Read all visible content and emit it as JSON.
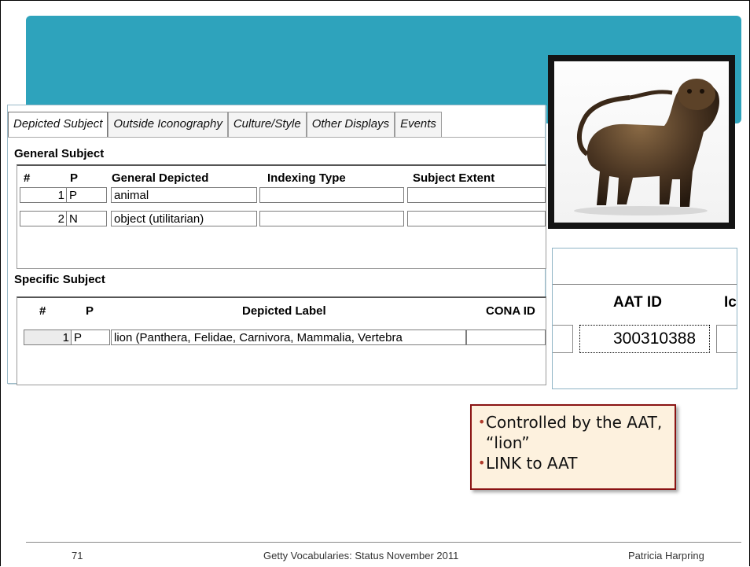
{
  "tabs": [
    "Depicted Subject",
    "Outside Iconography",
    "Culture/Style",
    "Other Displays",
    "Events"
  ],
  "general": {
    "title": "General Subject",
    "headers": [
      "#",
      "P",
      "General Depicted",
      "Indexing Type",
      "Subject Extent"
    ],
    "rows": [
      {
        "num": "1",
        "p": "P",
        "depicted": "animal",
        "type": "",
        "extent": ""
      },
      {
        "num": "2",
        "p": "N",
        "depicted": "object (utilitarian)",
        "type": "",
        "extent": ""
      }
    ]
  },
  "specific": {
    "title": "Specific Subject",
    "headers": [
      "#",
      "P",
      "Depicted Label",
      "CONA ID"
    ],
    "rows": [
      {
        "num": "1",
        "p": "P",
        "label": "lion (Panthera, Felidae, Carnivora, Mammalia, Vertebra",
        "cona": ""
      }
    ]
  },
  "inset": {
    "aat_header": "AAT ID",
    "next_header": "Ic",
    "aat_value": "300310388"
  },
  "callout": {
    "items": [
      "Controlled by the AAT, “lion”",
      "LINK to AAT"
    ]
  },
  "footer": {
    "page": "71",
    "title": "Getty Vocabularies: Status November 2011",
    "author": "Patricia Harpring"
  },
  "colors": {
    "banner": "#2ea3bc",
    "callout_border": "#8a1313",
    "callout_bg": "#fdf1de"
  }
}
